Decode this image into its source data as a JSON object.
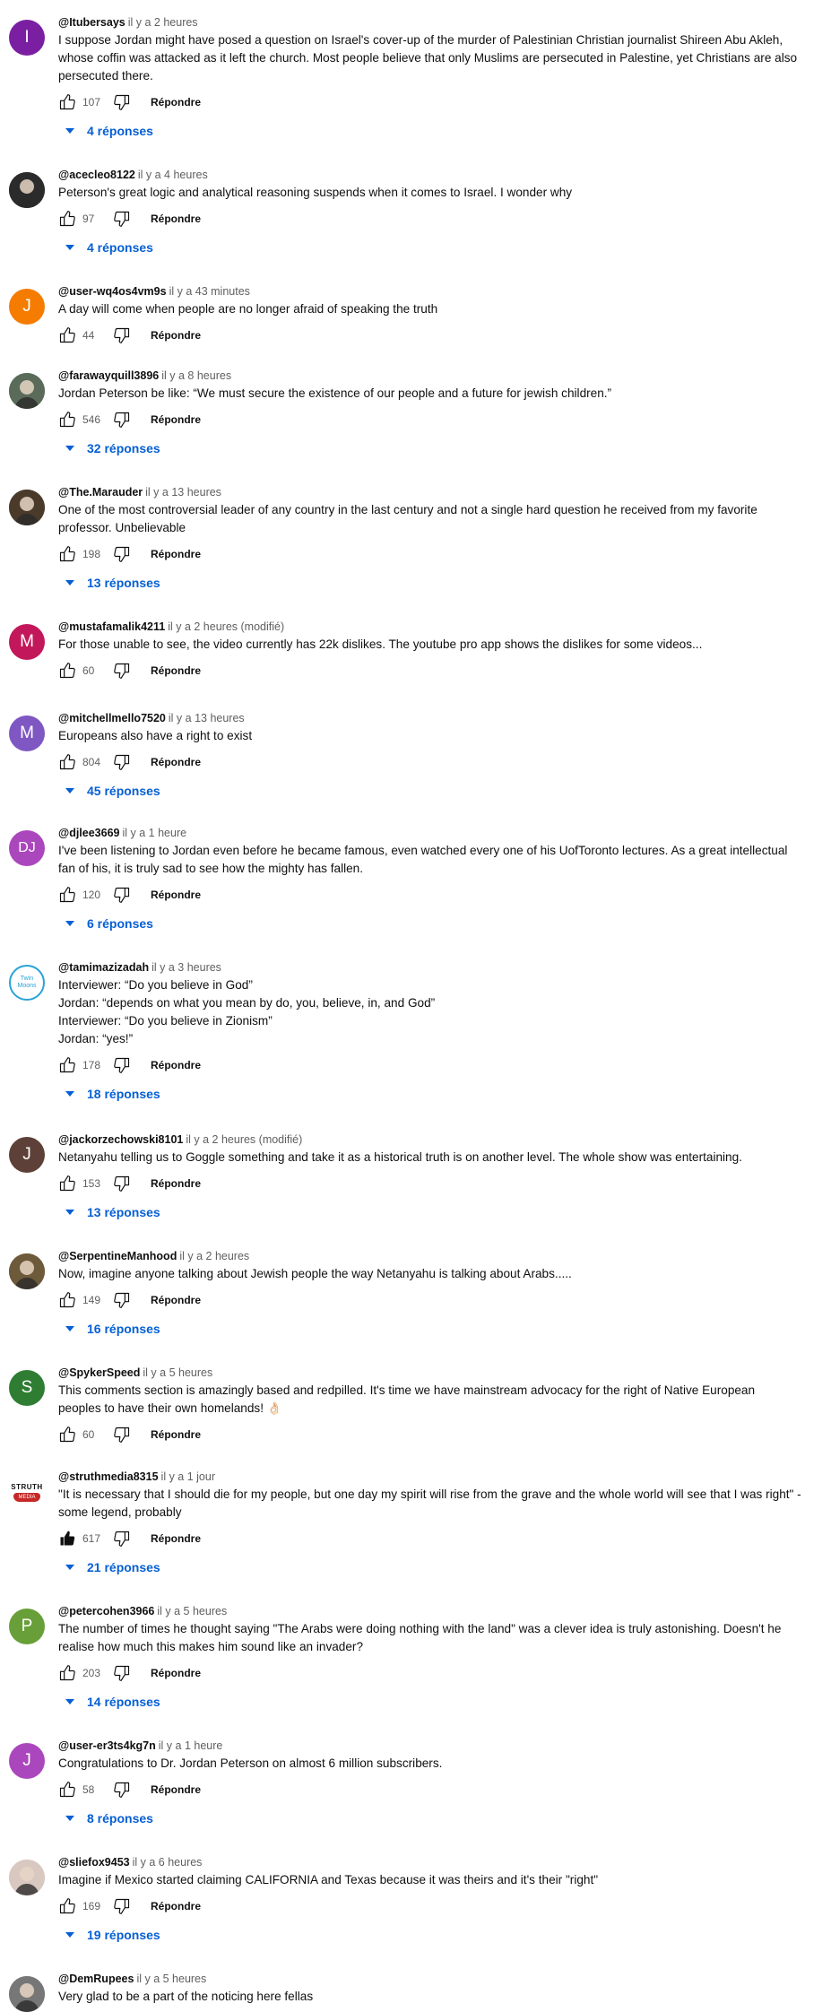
{
  "comments": [
    {
      "handle": "@Itubersays",
      "time": "il y a 2 heures",
      "avatar": {
        "letter": "I",
        "color": "#7b1fa2"
      },
      "text": [
        "I suppose Jordan might have posed a question on Israel's cover-up of the murder of Palestinian Christian journalist Shireen Abu Akleh,",
        "whose coffin was attacked as it left the church. Most people believe that only Muslims are persecuted in Palestine, yet Christians are also",
        "persecuted there."
      ],
      "likes": "107",
      "reply_label": "Répondre",
      "replies": "4 réponses",
      "liked": false
    },
    {
      "handle": "@acecleo8122",
      "time": "il y a 4 heures",
      "avatar": {
        "letter": "",
        "color": "#2b2b2b",
        "icon": "photo-avatar-icon"
      },
      "text": [
        "Peterson's great logic and analytical reasoning suspends when it comes to Israel. I wonder why"
      ],
      "likes": "97",
      "reply_label": "Répondre",
      "replies": "4 réponses",
      "liked": false
    },
    {
      "handle": "@user-wq4os4vm9s",
      "time": "il y a 43 minutes",
      "avatar": {
        "letter": "J",
        "color": "#f57c00"
      },
      "text": [
        "A day will come when people are no longer afraid of speaking the truth"
      ],
      "likes": "44",
      "reply_label": "Répondre",
      "replies": "",
      "liked": false
    },
    {
      "handle": "@farawayquill3896",
      "time": "il y a 8 heures",
      "avatar": {
        "letter": "",
        "color": "#5a6b5a",
        "icon": "photo-avatar-icon"
      },
      "text": [
        "Jordan Peterson be like: “We must secure the existence of our people and a future for jewish children.”"
      ],
      "likes": "546",
      "reply_label": "Répondre",
      "replies": "32 réponses",
      "liked": false
    },
    {
      "handle": "@The.Marauder",
      "time": "il y a 13 heures",
      "avatar": {
        "letter": "",
        "color": "#4a3a2a",
        "icon": "photo-avatar-icon"
      },
      "text": [
        "One of the most controversial leader of any country in the last century and not a single hard question he received from my favorite",
        "professor. Unbelievable"
      ],
      "likes": "198",
      "reply_label": "Répondre",
      "replies": "13 réponses",
      "liked": false
    },
    {
      "handle": "@mustafamalik4211",
      "time": "il y a 2 heures (modifié)",
      "avatar": {
        "letter": "M",
        "color": "#c2185b"
      },
      "text": [
        "For those unable to see, the video currently has 22k dislikes. The youtube pro app shows the dislikes for some videos..."
      ],
      "likes": "60",
      "reply_label": "Répondre",
      "replies": "",
      "liked": false
    },
    {
      "handle": "@mitchellmello7520",
      "time": "il y a 13 heures",
      "avatar": {
        "letter": "M",
        "color": "#7e57c2"
      },
      "text": [
        "Europeans also have a right to exist"
      ],
      "likes": "804",
      "reply_label": "Répondre",
      "replies": "45 réponses",
      "liked": false
    },
    {
      "handle": "@djlee3669",
      "time": "il y a 1 heure",
      "avatar": {
        "letter": "DJ",
        "color": "#ab47bc"
      },
      "text": [
        "I've been listening to Jordan even before he became famous, even watched every one of his UofToronto lectures. As a great intellectual",
        "fan of his, it is truly sad to see how the mighty has fallen."
      ],
      "likes": "120",
      "reply_label": "Répondre",
      "replies": "6 réponses",
      "liked": false
    },
    {
      "handle": "@tamimazizadah",
      "time": "il y a 3 heures",
      "avatar": {
        "letter": "",
        "color": "#ffffff",
        "icon": "tiwan-moons-logo-icon",
        "logo_text": "Twin Moons"
      },
      "text": [
        "Interviewer: “Do you believe in God”",
        "Jordan: “depends on what you mean by do, you, believe, in, and God”",
        "Interviewer: “Do you believe in Zionism”",
        "Jordan: “yes!”"
      ],
      "likes": "178",
      "reply_label": "Répondre",
      "replies": "18 réponses",
      "liked": false
    },
    {
      "handle": "@jackorzechowski8101",
      "time": "il y a 2 heures (modifié)",
      "avatar": {
        "letter": "J",
        "color": "#5d4037"
      },
      "text": [
        "Netanyahu telling us to Goggle something and take it as a historical truth is on another level. The whole show was entertaining."
      ],
      "likes": "153",
      "reply_label": "Répondre",
      "replies": "13 réponses",
      "liked": false
    },
    {
      "handle": "@SerpentineManhood",
      "time": "il y a 2 heures",
      "avatar": {
        "letter": "",
        "color": "#6d5a3a",
        "icon": "photo-avatar-icon"
      },
      "text": [
        "Now, imagine anyone talking about Jewish people the way Netanyahu is talking about Arabs....."
      ],
      "likes": "149",
      "reply_label": "Répondre",
      "replies": "16 réponses",
      "liked": false
    },
    {
      "handle": "@SpykerSpeed",
      "time": "il y a 5 heures",
      "avatar": {
        "letter": "S",
        "color": "#2e7d32"
      },
      "text": [
        "This comments section is amazingly based and redpilled. It's time we have mainstream advocacy for the right of Native European",
        "peoples to have their own homelands! 👌🏻"
      ],
      "likes": "60",
      "reply_label": "Répondre",
      "replies": "",
      "liked": false
    },
    {
      "handle": "@struthmedia8315",
      "time": "il y a 1 jour",
      "avatar": {
        "letter": "",
        "color": "#ffffff",
        "icon": "struth-media-logo-icon",
        "logo_text": "STRUTH",
        "logo_sub": "MEDIA"
      },
      "text": [
        "\"It is necessary that I should die for my people, but one day my spirit will rise from the grave and the whole world will see that I was right\" -",
        "some legend, probably"
      ],
      "likes": "617",
      "reply_label": "Répondre",
      "replies": "21 réponses",
      "liked": true
    },
    {
      "handle": "@petercohen3966",
      "time": "il y a 5 heures",
      "avatar": {
        "letter": "P",
        "color": "#689f38"
      },
      "text": [
        "The number of times he thought saying \"The Arabs were doing nothing with the land\" was a clever idea is truly astonishing. Doesn't he",
        "realise how much this makes him sound like an invader?"
      ],
      "likes": "203",
      "reply_label": "Répondre",
      "replies": "14 réponses",
      "liked": false
    },
    {
      "handle": "@user-er3ts4kg7n",
      "time": "il y a 1 heure",
      "avatar": {
        "letter": "J",
        "color": "#ab47bc"
      },
      "text": [
        "Congratulations to Dr. Jordan Peterson on almost 6 million subscribers."
      ],
      "likes": "58",
      "reply_label": "Répondre",
      "replies": "8 réponses",
      "liked": false
    },
    {
      "handle": "@sliefox9453",
      "time": "il y a 6 heures",
      "avatar": {
        "letter": "",
        "color": "#d8c8c0",
        "icon": "photo-avatar-icon"
      },
      "text": [
        "Imagine if Mexico started claiming CALIFORNIA and Texas because it was theirs and it's their \"right\""
      ],
      "likes": "169",
      "reply_label": "Répondre",
      "replies": "19 réponses",
      "liked": false
    },
    {
      "handle": "@DemRupees",
      "time": "il y a 5 heures",
      "avatar": {
        "letter": "",
        "color": "#777777",
        "icon": "photo-avatar-icon"
      },
      "text": [
        "Very glad to be a part of the noticing here fellas"
      ],
      "likes": "",
      "reply_label": "",
      "replies": "",
      "liked": false
    }
  ]
}
